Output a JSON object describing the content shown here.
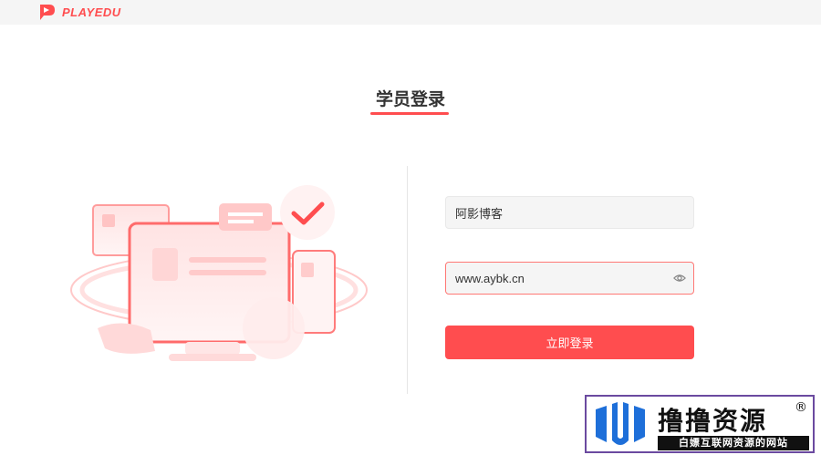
{
  "header": {
    "brand": "PLAYEDU"
  },
  "login": {
    "title": "学员登录",
    "username_value": "阿影博客",
    "password_value": "www.aybk.cn",
    "submit_label": "立即登录"
  },
  "watermark": {
    "title": "撸撸资源",
    "subtitle": "白嫖互联网资源的网站",
    "registered_mark": "®"
  },
  "colors": {
    "accent": "#ff4d4f",
    "topbar": "#f5f5f5",
    "field_bg": "#f5f5f5",
    "watermark_border": "#6b4aa0",
    "watermark_logo_blue": "#1e6fd9"
  },
  "icons": {
    "brand": "play-logo-icon",
    "password_toggle": "eye-icon",
    "watermark": "water-drop-logo-icon"
  }
}
